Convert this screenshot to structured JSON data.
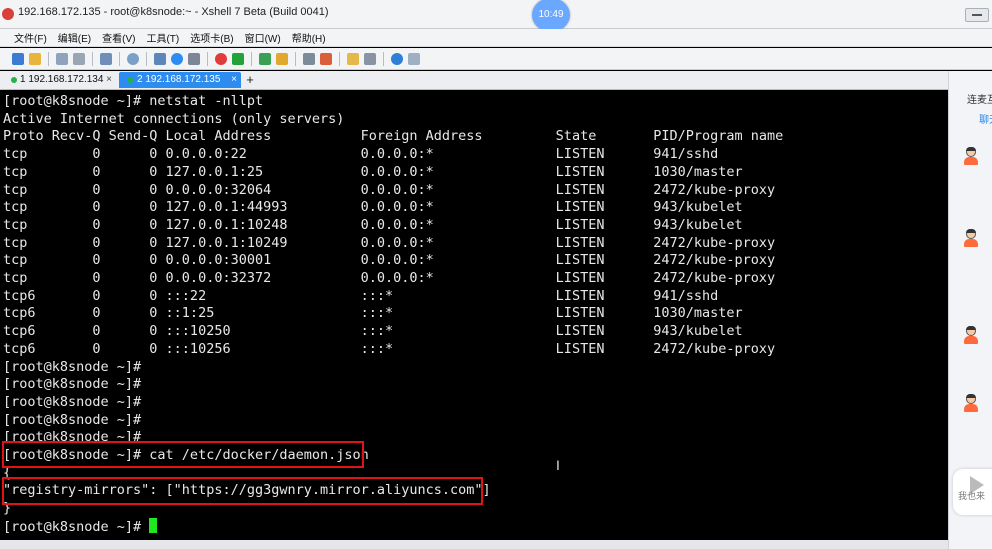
{
  "window": {
    "title": "192.168.172.135 - root@k8snode:~ - Xshell 7 Beta (Build 0041)",
    "clock": "10:49"
  },
  "menu": [
    "文件(F)",
    "编辑(E)",
    "查看(V)",
    "工具(T)",
    "选项卡(B)",
    "窗口(W)",
    "帮助(H)"
  ],
  "toolbar_icons": [
    "new-session-icon",
    "open-folder-icon",
    "connect-icon",
    "disconnect-icon",
    "reconnect-icon",
    "find-icon",
    "properties-icon",
    "color-scheme-icon",
    "font-icon",
    "xftp-icon",
    "xshell-icon",
    "fullscreen-icon",
    "lock-icon",
    "compose-bar-icon",
    "highlight-icon",
    "script-icon",
    "layout-icon",
    "help-icon",
    "chat-icon"
  ],
  "tabs": [
    {
      "label": "1 192.168.172.134",
      "active": false
    },
    {
      "label": "2 192.168.172.135",
      "active": true
    }
  ],
  "terminal": {
    "lines": [
      "[root@k8snode ~]# netstat -nllpt",
      "Active Internet connections (only servers)",
      "Proto Recv-Q Send-Q Local Address           Foreign Address         State       PID/Program name",
      "tcp        0      0 0.0.0.0:22              0.0.0.0:*               LISTEN      941/sshd",
      "tcp        0      0 127.0.0.1:25            0.0.0.0:*               LISTEN      1030/master",
      "tcp        0      0 0.0.0.0:32064           0.0.0.0:*               LISTEN      2472/kube-proxy",
      "tcp        0      0 127.0.0.1:44993         0.0.0.0:*               LISTEN      943/kubelet",
      "tcp        0      0 127.0.0.1:10248         0.0.0.0:*               LISTEN      943/kubelet",
      "tcp        0      0 127.0.0.1:10249         0.0.0.0:*               LISTEN      2472/kube-proxy",
      "tcp        0      0 0.0.0.0:30001           0.0.0.0:*               LISTEN      2472/kube-proxy",
      "tcp        0      0 0.0.0.0:32372           0.0.0.0:*               LISTEN      2472/kube-proxy",
      "tcp6       0      0 :::22                   :::*                    LISTEN      941/sshd",
      "tcp6       0      0 ::1:25                  :::*                    LISTEN      1030/master",
      "tcp6       0      0 :::10250                :::*                    LISTEN      943/kubelet",
      "tcp6       0      0 :::10256                :::*                    LISTEN      2472/kube-proxy",
      "[root@k8snode ~]#",
      "[root@k8snode ~]#",
      "[root@k8snode ~]#",
      "[root@k8snode ~]#",
      "[root@k8snode ~]#",
      "[root@k8snode ~]# cat /etc/docker/daemon.json",
      "{",
      "\"registry-mirrors\": [\"https://gg3gwnry.mirror.aliyuncs.com\"]",
      "}"
    ],
    "prompt": "[root@k8snode ~]# "
  },
  "side_panel": {
    "label_top": "连麦互",
    "label_tab": "聊天",
    "label_bottom": "我也来"
  },
  "status_bar": "",
  "colors": {
    "terminal_bg": "#000000",
    "terminal_fg": "#e8e8e8",
    "cursor": "#1eea1e",
    "active_tab": "#2d8cf0",
    "highlight_box": "#e01414"
  }
}
